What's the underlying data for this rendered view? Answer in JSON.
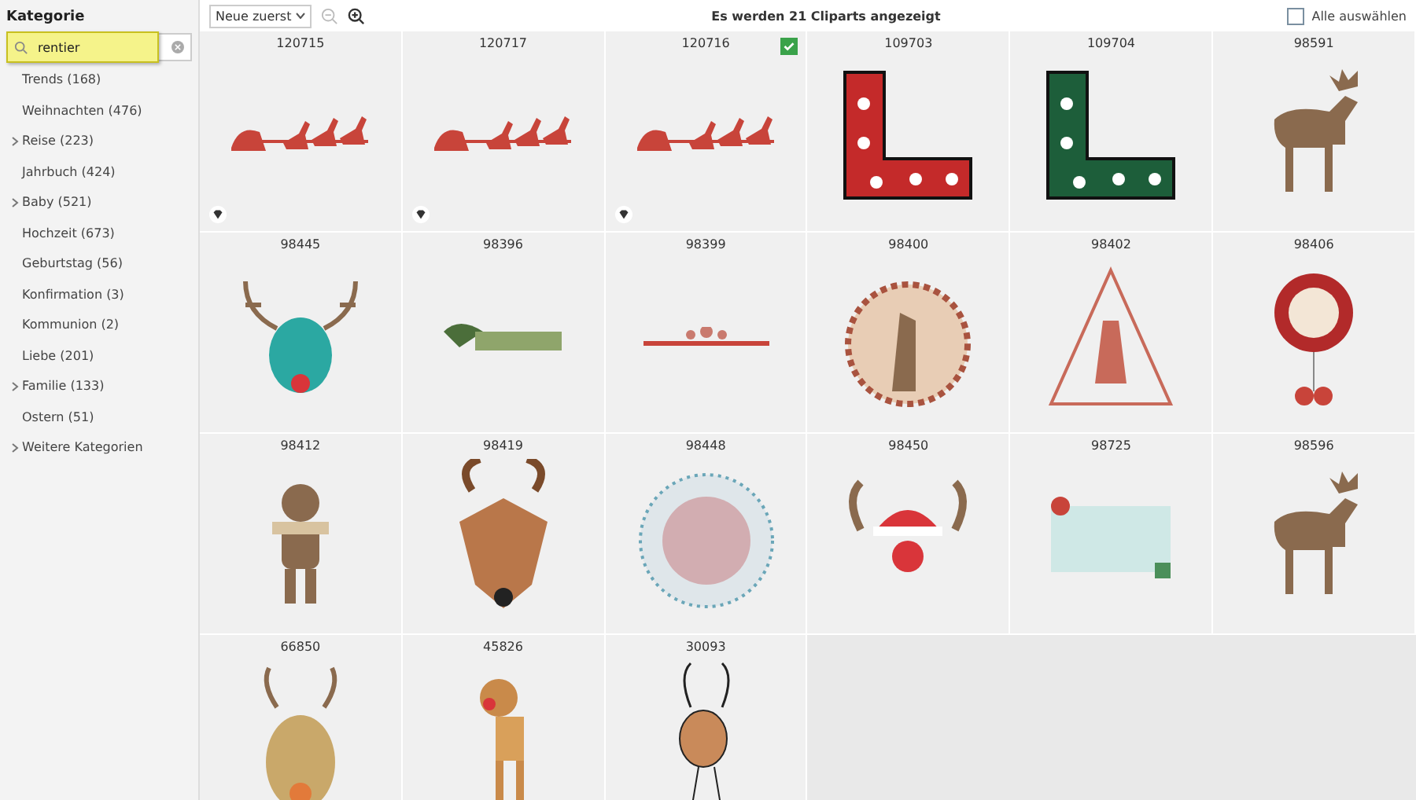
{
  "sidebar": {
    "title": "Kategorie",
    "search": {
      "value": "rentier"
    },
    "items": [
      {
        "label": "Trends (168)",
        "expandable": false
      },
      {
        "label": "Weihnachten (476)",
        "expandable": false
      },
      {
        "label": "Reise (223)",
        "expandable": true
      },
      {
        "label": "Jahrbuch (424)",
        "expandable": false
      },
      {
        "label": "Baby (521)",
        "expandable": true
      },
      {
        "label": "Hochzeit (673)",
        "expandable": false
      },
      {
        "label": "Geburtstag (56)",
        "expandable": false
      },
      {
        "label": "Konfirmation (3)",
        "expandable": false
      },
      {
        "label": "Kommunion (2)",
        "expandable": false
      },
      {
        "label": "Liebe (201)",
        "expandable": false
      },
      {
        "label": "Familie (133)",
        "expandable": true
      },
      {
        "label": "Ostern (51)",
        "expandable": false
      },
      {
        "label": "Weitere Kategorien",
        "expandable": true
      }
    ]
  },
  "toolbar": {
    "sort": "Neue zuerst",
    "status": "Es werden 21 Cliparts angezeigt",
    "select_all": {
      "label": "Alle auswählen",
      "checked": false
    }
  },
  "cliparts": [
    {
      "id": "120715",
      "kind": "sleigh",
      "premium": true,
      "selected": false
    },
    {
      "id": "120717",
      "kind": "sleigh",
      "premium": true,
      "selected": false
    },
    {
      "id": "120716",
      "kind": "sleigh",
      "premium": true,
      "selected": true
    },
    {
      "id": "109703",
      "kind": "redcorner",
      "premium": false,
      "selected": false
    },
    {
      "id": "109704",
      "kind": "greencorner",
      "premium": false,
      "selected": false
    },
    {
      "id": "98591",
      "kind": "moose",
      "premium": false,
      "selected": false
    },
    {
      "id": "98445",
      "kind": "head",
      "premium": false,
      "selected": false
    },
    {
      "id": "98396",
      "kind": "banner",
      "premium": false,
      "selected": false
    },
    {
      "id": "98399",
      "kind": "border",
      "premium": false,
      "selected": false
    },
    {
      "id": "98400",
      "kind": "medallion",
      "premium": false,
      "selected": false
    },
    {
      "id": "98402",
      "kind": "tree",
      "premium": false,
      "selected": false
    },
    {
      "id": "98406",
      "kind": "seal",
      "premium": false,
      "selected": false
    },
    {
      "id": "98412",
      "kind": "figure",
      "premium": false,
      "selected": false
    },
    {
      "id": "98419",
      "kind": "fawn",
      "premium": false,
      "selected": false
    },
    {
      "id": "98448",
      "kind": "wreath",
      "premium": false,
      "selected": false
    },
    {
      "id": "98450",
      "kind": "nose",
      "premium": false,
      "selected": false
    },
    {
      "id": "98725",
      "kind": "card",
      "premium": false,
      "selected": false
    },
    {
      "id": "98596",
      "kind": "moose",
      "premium": false,
      "selected": false
    },
    {
      "id": "66850",
      "kind": "cartoon",
      "premium": false,
      "selected": false
    },
    {
      "id": "45826",
      "kind": "standing",
      "premium": false,
      "selected": false
    },
    {
      "id": "30093",
      "kind": "sketch",
      "premium": false,
      "selected": false
    }
  ]
}
